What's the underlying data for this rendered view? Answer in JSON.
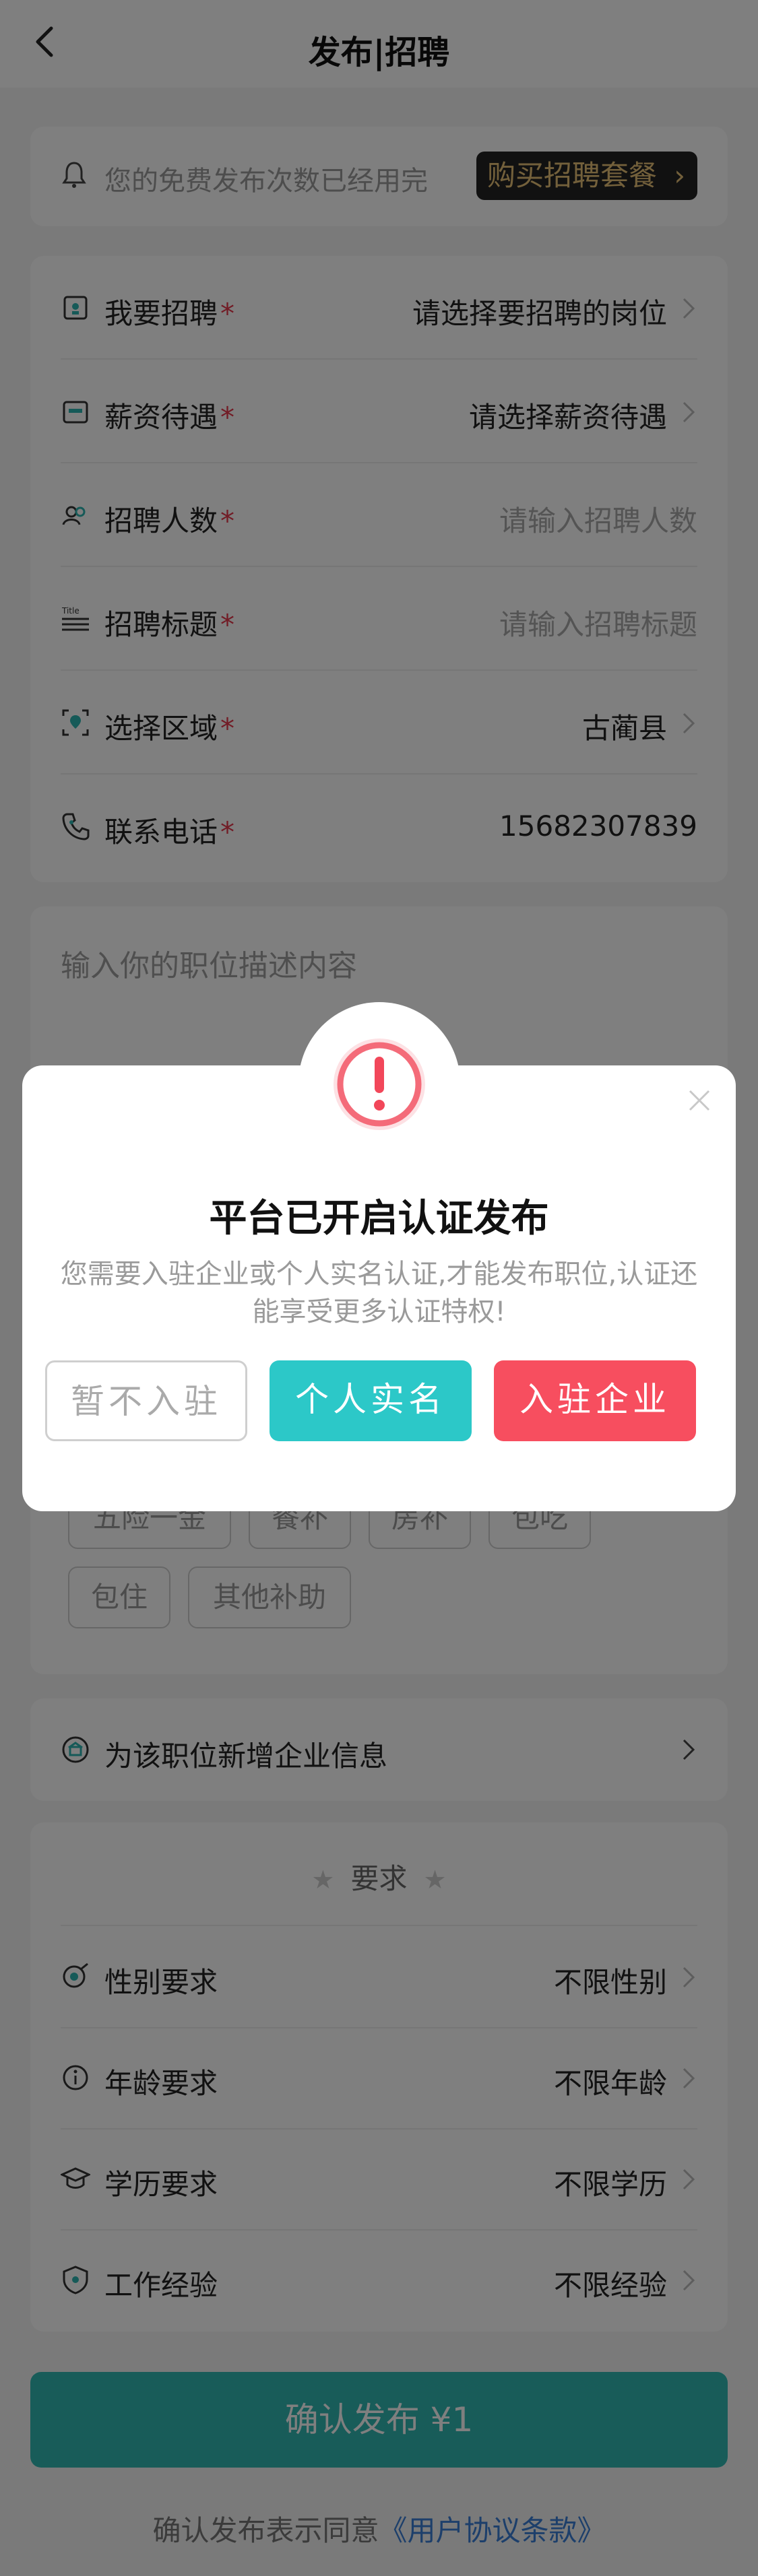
{
  "header": {
    "title": "发布|招聘"
  },
  "notice": {
    "text": "您的免费发布次数已经用完",
    "buy_label": "购买招聘套餐"
  },
  "form": {
    "rows": [
      {
        "label": "我要招聘",
        "value": "请选择要招聘的岗位",
        "icon": "job-icon"
      },
      {
        "label": "薪资待遇",
        "value": "请选择薪资待遇",
        "icon": "wallet-icon"
      },
      {
        "label": "招聘人数",
        "placeholder": "请输入招聘人数",
        "icon": "people-icon"
      },
      {
        "label": "招聘标题",
        "placeholder": "请输入招聘标题",
        "icon": "title-icon"
      },
      {
        "label": "选择区域",
        "value": "古蔺县",
        "icon": "location-icon"
      },
      {
        "label": "联系电话",
        "value": "15682307839",
        "icon": "phone-icon"
      }
    ],
    "required_mark": "*"
  },
  "description": {
    "placeholder": "输入你的职位描述内容",
    "tags": [
      "五险一金",
      "餐补",
      "房补",
      "包吃",
      "包住",
      "其他补助"
    ]
  },
  "company": {
    "label": "为该职位新增企业信息"
  },
  "requirements": {
    "title": "要求",
    "rows": [
      {
        "label": "性别要求",
        "value": "不限性别"
      },
      {
        "label": "年龄要求",
        "value": "不限年龄"
      },
      {
        "label": "学历要求",
        "value": "不限学历"
      },
      {
        "label": "工作经验",
        "value": "不限经验"
      }
    ]
  },
  "confirm": {
    "label": "确认发布 ¥1"
  },
  "agreement": {
    "prefix": "确认发布表示同意",
    "link": "《用户协议条款》"
  },
  "modal": {
    "title": "平台已开启认证发布",
    "subtitle": "您需要入驻企业或个人实名认证,才能发布职位,认证还能享受更多认证特权!",
    "buttons": {
      "skip": "暂不入驻",
      "personal": "个人实名",
      "enterprise": "入驻企业"
    }
  },
  "colors": {
    "accent": "#30b8b3",
    "danger": "#f74e5f",
    "teal": "#2cc8c8",
    "gold": "#e6c177"
  }
}
